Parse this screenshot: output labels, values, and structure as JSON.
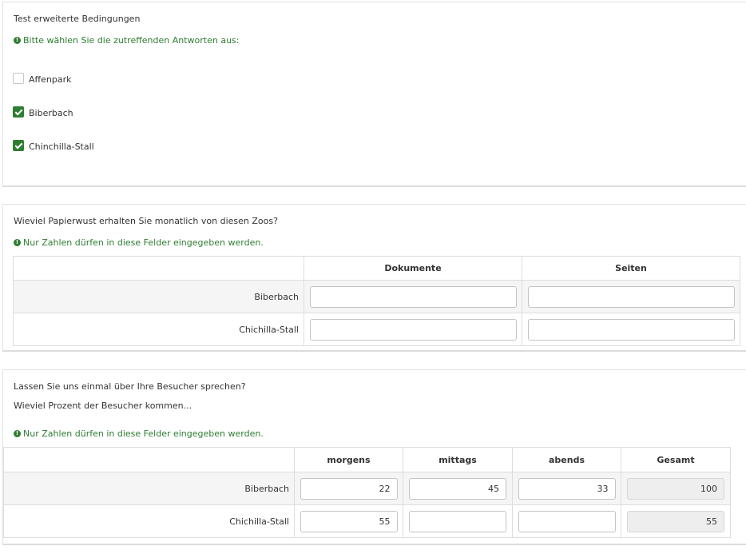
{
  "q1": {
    "text": "Test erweiterte Bedingungen",
    "tip": "Bitte wählen Sie die zutreffenden Antworten aus:",
    "options": [
      {
        "label": "Affenpark",
        "checked": false
      },
      {
        "label": "Biberbach",
        "checked": true
      },
      {
        "label": "Chinchilla-Stall",
        "checked": true
      }
    ]
  },
  "q2": {
    "text": "Wieviel Papierwust erhalten Sie monatlich von diesen Zoos?",
    "tip": "Nur Zahlen dürfen in diese Felder eingegeben werden.",
    "columns": [
      "Dokumente",
      "Seiten"
    ],
    "rows": [
      {
        "label": "Biberbach",
        "values": [
          "",
          ""
        ]
      },
      {
        "label": "Chichilla-Stall",
        "values": [
          "",
          ""
        ]
      }
    ]
  },
  "q3": {
    "text": "Lassen Sie uns einmal über Ihre Besucher sprechen?",
    "subtext": "Wieviel Prozent der Besucher kommen...",
    "tip": "Nur Zahlen dürfen in diese Felder eingegeben werden.",
    "columns": [
      "morgens",
      "mittags",
      "abends",
      "Gesamt"
    ],
    "rows": [
      {
        "label": "Biberbach",
        "values": [
          "22",
          "45",
          "33"
        ],
        "total": "100"
      },
      {
        "label": "Chichilla-Stall",
        "values": [
          "55",
          "",
          ""
        ],
        "total": "55"
      }
    ]
  },
  "icons": {
    "tip": "exclamation-circle-icon"
  },
  "colors": {
    "accent": "#2e7d32",
    "border": "#dddddd",
    "alt_row": "#f5f5f5"
  }
}
